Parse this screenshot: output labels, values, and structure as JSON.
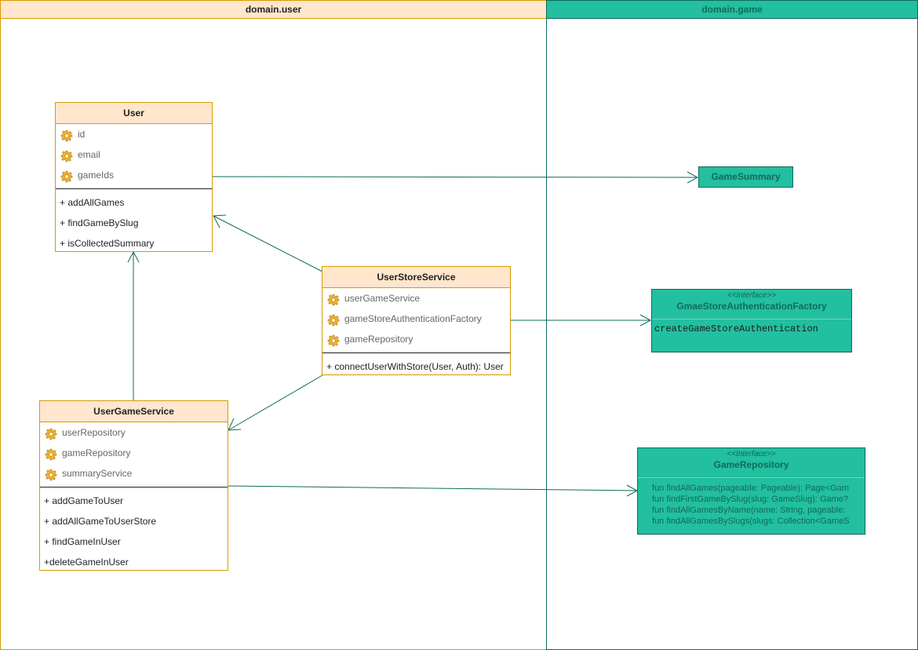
{
  "packages": {
    "user": {
      "title": "domain.user"
    },
    "game": {
      "title": "domain.game"
    }
  },
  "user_class": {
    "title": "User",
    "attributes": [
      "id",
      "email",
      "gameIds"
    ],
    "operations": [
      "+ addAllGames",
      "+ findGameBySlug",
      "+ isCollectedSummary"
    ]
  },
  "user_store_service": {
    "title": "UserStoreService",
    "attributes": [
      "userGameService",
      "gameStoreAuthenticationFactory",
      "gameRepository"
    ],
    "operations": [
      "+ connectUserWithStore(User, Auth): User"
    ]
  },
  "user_game_service": {
    "title": "UserGameService",
    "attributes": [
      "userRepository",
      "gameRepository",
      "summaryService"
    ],
    "operations": [
      "+ addGameToUser",
      "+ addAllGameToUserStore",
      "+ findGameInUser",
      "+deleteGameInUser"
    ]
  },
  "game_summary": {
    "title": "GameSummary"
  },
  "auth_factory": {
    "stereotype": "<<Interface>>",
    "title": "GmaeStoreAuthenticationFactory",
    "method": "createGameStoreAuthentication"
  },
  "game_repository": {
    "stereotype": "<<Interface>>",
    "title": "GameRepository",
    "methods": [
      "fun findAllGames(pageable: Pageable): Page<Gam",
      "fun findFirstGameBySlug(slug: GameSlug): Game?",
      "fun findAllGamesByName(name: String, pageable:",
      "fun findAllGamesBySlugs(slugs: Collection<GameS"
    ]
  },
  "colors": {
    "user_fill": "#ffe6cc",
    "user_stroke": "#d79b00",
    "game_fill": "#22bfa0",
    "game_stroke": "#0e6b5f"
  },
  "icons": {
    "attribute": "gear-icon"
  }
}
